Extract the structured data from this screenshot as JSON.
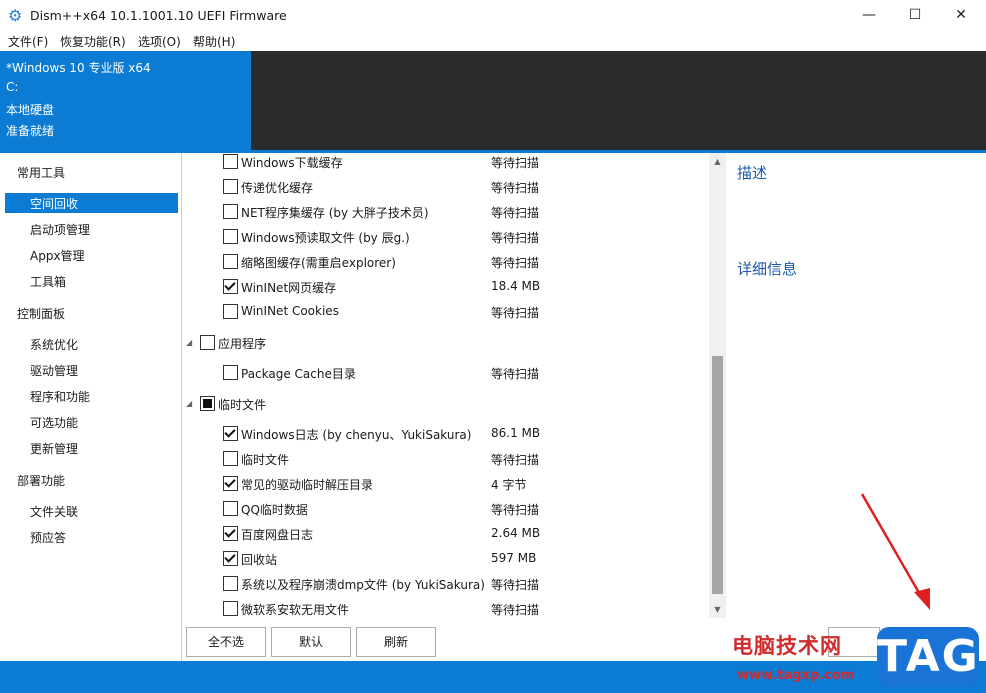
{
  "window": {
    "title": "Dism++x64 10.1.1001.10 UEFI Firmware",
    "minimize_glyph": "—",
    "maximize_glyph": "☐",
    "close_glyph": "✕"
  },
  "menu": [
    "文件(F)",
    "恢复功能(R)",
    "选项(O)",
    "帮助(H)"
  ],
  "header": {
    "os": "*Windows 10 专业版 x64",
    "drive": "C:",
    "disk": "本地硬盘",
    "status": "准备就绪"
  },
  "nav": {
    "sections": [
      {
        "label": "常用工具",
        "items": [
          "空间回收",
          "启动项管理",
          "Appx管理",
          "工具箱"
        ]
      },
      {
        "label": "控制面板",
        "items": [
          "系统优化",
          "驱动管理",
          "程序和功能",
          "可选功能",
          "更新管理"
        ]
      },
      {
        "label": "部署功能",
        "items": [
          "文件关联",
          "预应答"
        ]
      }
    ],
    "selected": "空间回收"
  },
  "list": {
    "rows": [
      {
        "label": "Windows下载缓存",
        "status": "等待扫描",
        "checked": false,
        "level": 1
      },
      {
        "label": "传递优化缓存",
        "status": "等待扫描",
        "checked": false,
        "level": 1
      },
      {
        "label": "NET程序集缓存 (by 大胖子技术员)",
        "status": "等待扫描",
        "checked": false,
        "level": 1
      },
      {
        "label": "Windows预读取文件 (by 辰g.)",
        "status": "等待扫描",
        "checked": false,
        "level": 1
      },
      {
        "label": "缩略图缓存(需重启explorer)",
        "status": "等待扫描",
        "checked": false,
        "level": 1
      },
      {
        "label": "WinINet网页缓存",
        "status": "18.4 MB",
        "checked": true,
        "level": 1
      },
      {
        "label": "WinINet Cookies",
        "status": "等待扫描",
        "checked": false,
        "level": 1
      },
      {
        "label": "应用程序",
        "status": "",
        "checked": false,
        "level": 0
      },
      {
        "label": "Package Cache目录",
        "status": "等待扫描",
        "checked": false,
        "level": 1
      },
      {
        "label": "临时文件",
        "status": "",
        "checked": "partial",
        "level": 0
      },
      {
        "label": "Windows日志 (by chenyu、YukiSakura)",
        "status": "86.1 MB",
        "checked": true,
        "level": 1
      },
      {
        "label": "临时文件",
        "status": "等待扫描",
        "checked": false,
        "level": 1
      },
      {
        "label": "常见的驱动临时解压目录",
        "status": "4 字节",
        "checked": true,
        "level": 1
      },
      {
        "label": "QQ临时数据",
        "status": "等待扫描",
        "checked": false,
        "level": 1
      },
      {
        "label": "百度网盘日志",
        "status": "2.64 MB",
        "checked": true,
        "level": 1
      },
      {
        "label": "回收站",
        "status": "597 MB",
        "checked": true,
        "level": 1
      },
      {
        "label": "系统以及程序崩溃dmp文件 (by YukiSakura)",
        "status": "等待扫描",
        "checked": false,
        "level": 1
      },
      {
        "label": "微软系安软无用文件",
        "status": "等待扫描",
        "checked": false,
        "level": 1
      }
    ]
  },
  "right_panel": {
    "describe": "描述",
    "details": "详细信息"
  },
  "buttons": {
    "deselect_all": "全不选",
    "default": "默认",
    "refresh": "刷新"
  },
  "watermark": {
    "site_cn": "电脑技术网",
    "url": "www.tagxp.com",
    "tag": "TAG"
  },
  "colors": {
    "accent": "#0b7bd4",
    "header_dark": "#2b2b2b",
    "link_blue": "#1c5aa8",
    "watermark_red": "#d12c2c"
  },
  "icons": {
    "app": "gears-icon",
    "expander": "triangle-down-icon"
  }
}
